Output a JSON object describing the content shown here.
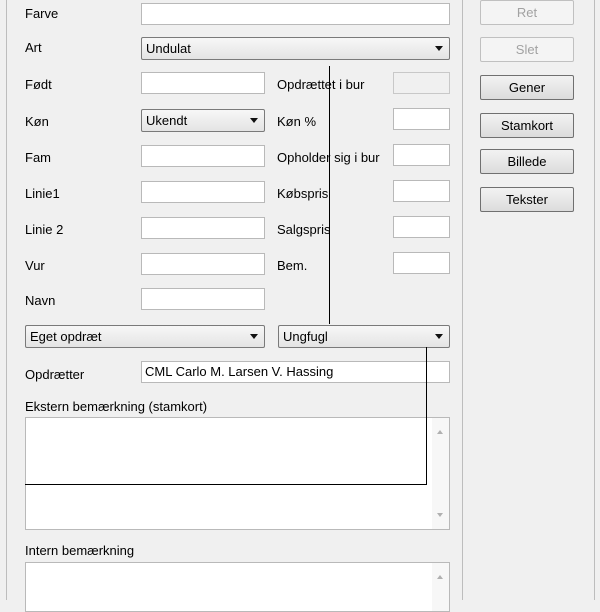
{
  "form": {
    "farve": {
      "label": "Farve",
      "value": ""
    },
    "art": {
      "label": "Art",
      "value": "Undulat"
    },
    "fodt": {
      "label": "Født",
      "value": ""
    },
    "kon": {
      "label": "Køn",
      "value": "Ukendt"
    },
    "fam": {
      "label": "Fam",
      "value": ""
    },
    "linie1": {
      "label": "Linie1",
      "value": ""
    },
    "linie2": {
      "label": "Linie 2",
      "value": ""
    },
    "vur": {
      "label": "Vur",
      "value": ""
    },
    "navn": {
      "label": "Navn",
      "value": ""
    },
    "opdraettet_i_bur": {
      "label": "Opdrættet i bur",
      "value": ""
    },
    "kon_pct": {
      "label": "Køn %",
      "value": ""
    },
    "opholder_sig_i_bur": {
      "label": "Opholder sig i bur",
      "value": ""
    },
    "kobspris": {
      "label": "Købspris",
      "value": ""
    },
    "salgspris": {
      "label": "Salgspris",
      "value": ""
    },
    "bem": {
      "label": "Bem.",
      "value": ""
    },
    "opdraet_type": {
      "value": "Eget opdræt"
    },
    "alder_type": {
      "value": "Ungfugl"
    },
    "opdraetter": {
      "label": "Opdrætter",
      "value": "CML Carlo M. Larsen V. Hassing"
    },
    "ekstern": {
      "label": "Ekstern bemærkning (stamkort)",
      "value": ""
    },
    "intern": {
      "label": "Intern bemærkning",
      "value": ""
    }
  },
  "buttons": {
    "ret": "Ret",
    "slet": "Slet",
    "gener": "Gener",
    "stamkort": "Stamkort",
    "billede": "Billede",
    "tekster": "Tekster"
  }
}
